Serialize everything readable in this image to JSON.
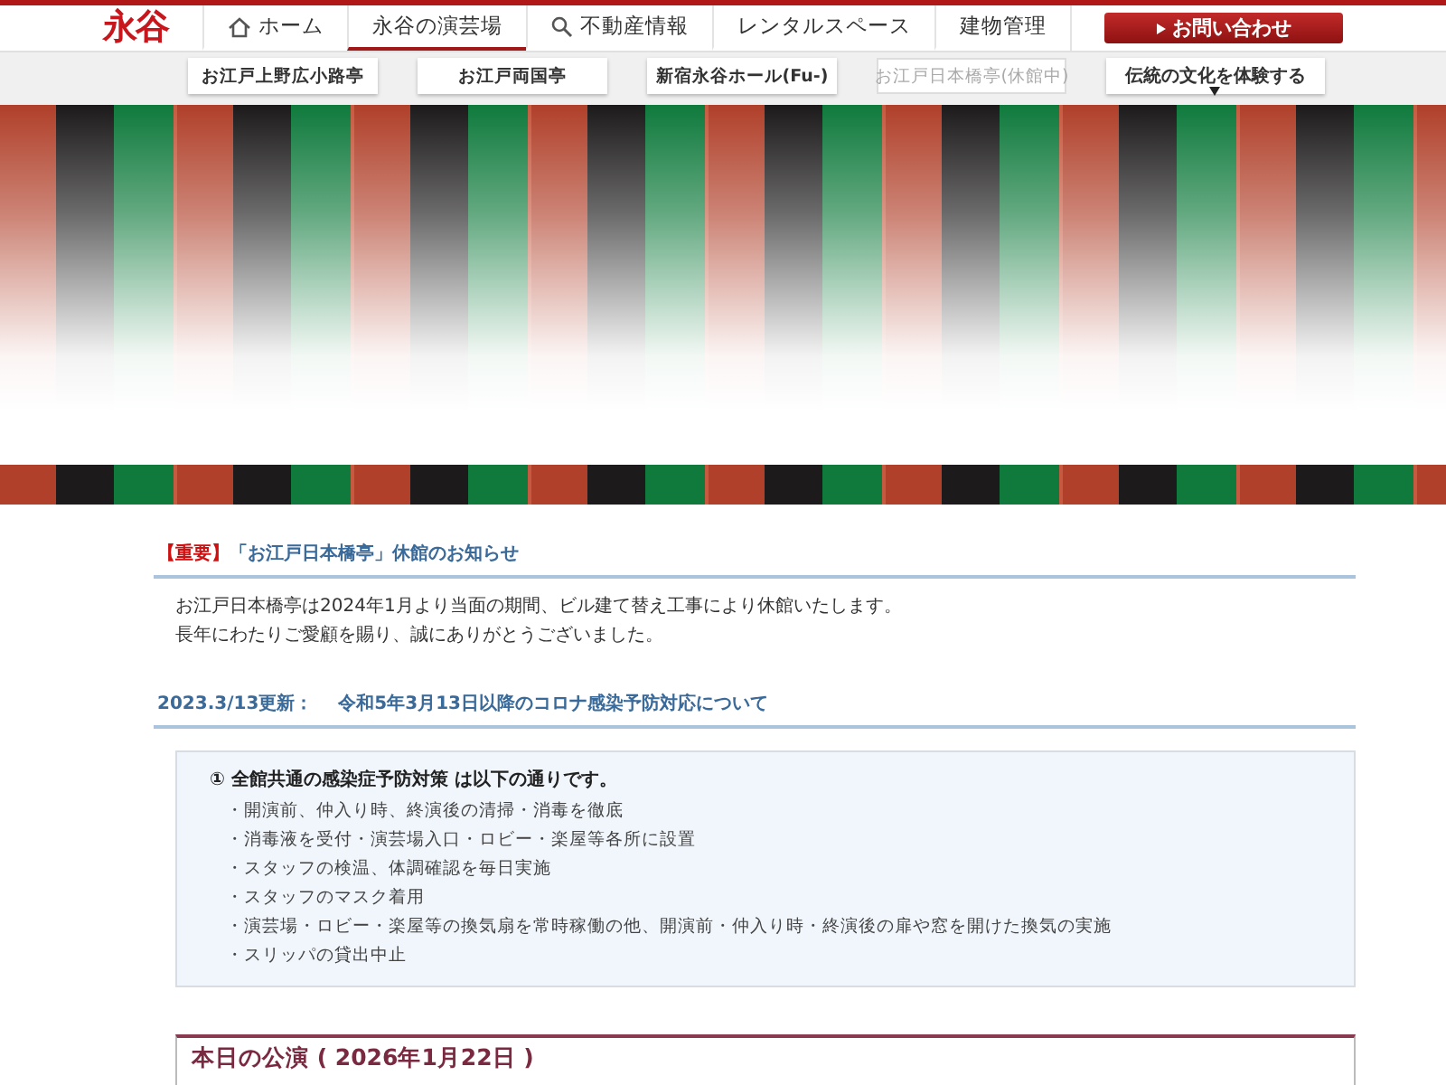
{
  "header": {
    "logo": "永谷",
    "nav": [
      {
        "label": "ホーム",
        "kind": "home",
        "selected": false
      },
      {
        "label": "永谷の演芸場",
        "kind": "plain",
        "selected": true
      },
      {
        "label": "不動産情報",
        "kind": "search",
        "selected": false
      },
      {
        "label": "レンタルスペース",
        "kind": "plain",
        "selected": false
      },
      {
        "label": "建物管理",
        "kind": "plain",
        "selected": false
      }
    ],
    "contact": "お問い合わせ"
  },
  "subnav": [
    {
      "label": "お江戸上野広小路亭",
      "kind": "link",
      "disabled": false
    },
    {
      "label": "お江戸両国亭",
      "kind": "link",
      "disabled": false
    },
    {
      "label": "新宿永谷ホール(Fu-)",
      "kind": "link",
      "disabled": false
    },
    {
      "label": "お江戸日本橋亭(休館中)",
      "kind": "link",
      "disabled": true
    },
    {
      "label": "伝統の文化を体験する",
      "kind": "dropdown",
      "disabled": false
    }
  ],
  "notice": {
    "tag": "【重要】",
    "title": "「お江戸日本橋亭」休館のお知らせ",
    "lines": [
      "お江戸日本橋亭は2024年1月より当面の期間、ビル建て替え工事により休館いたします。",
      "長年にわたりご愛顧を賜り、誠にありがとうございました。"
    ]
  },
  "update": {
    "date": "2023.3/13更新：",
    "title": "令和5年3月13日以降のコロナ感染予防対応について"
  },
  "measures": {
    "heading": "① 全館共通の感染症予防対策 は以下の通りです。",
    "items": [
      "・開演前、仲入り時、終演後の清掃・消毒を徹底",
      "・消毒液を受付・演芸場入口・ロビー・楽屋等各所に設置",
      "・スタッフの検温、体調確認を毎日実施",
      "・スタッフのマスク着用",
      "・演芸場・ロビー・楽屋等の換気扇を常時稼働の他、開演前・仲入り時・終演後の扉や窓を開けた換気の実施",
      "・スリッパの貸出中止"
    ]
  },
  "today": {
    "title": "本日の公演 ( 2026年1月22日 )"
  }
}
